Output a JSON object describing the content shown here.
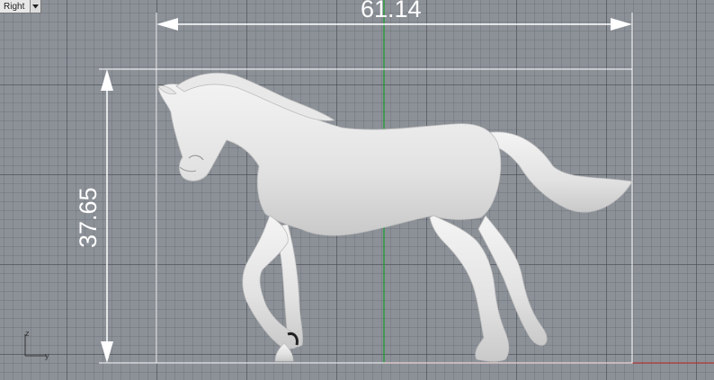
{
  "viewport": {
    "name": "Right"
  },
  "dimensions": {
    "width": "61.14",
    "height": "37.65"
  },
  "axes": {
    "vertical": "z",
    "horizontal": "y"
  },
  "icons": {
    "dropdown": "chevron-down-icon"
  }
}
